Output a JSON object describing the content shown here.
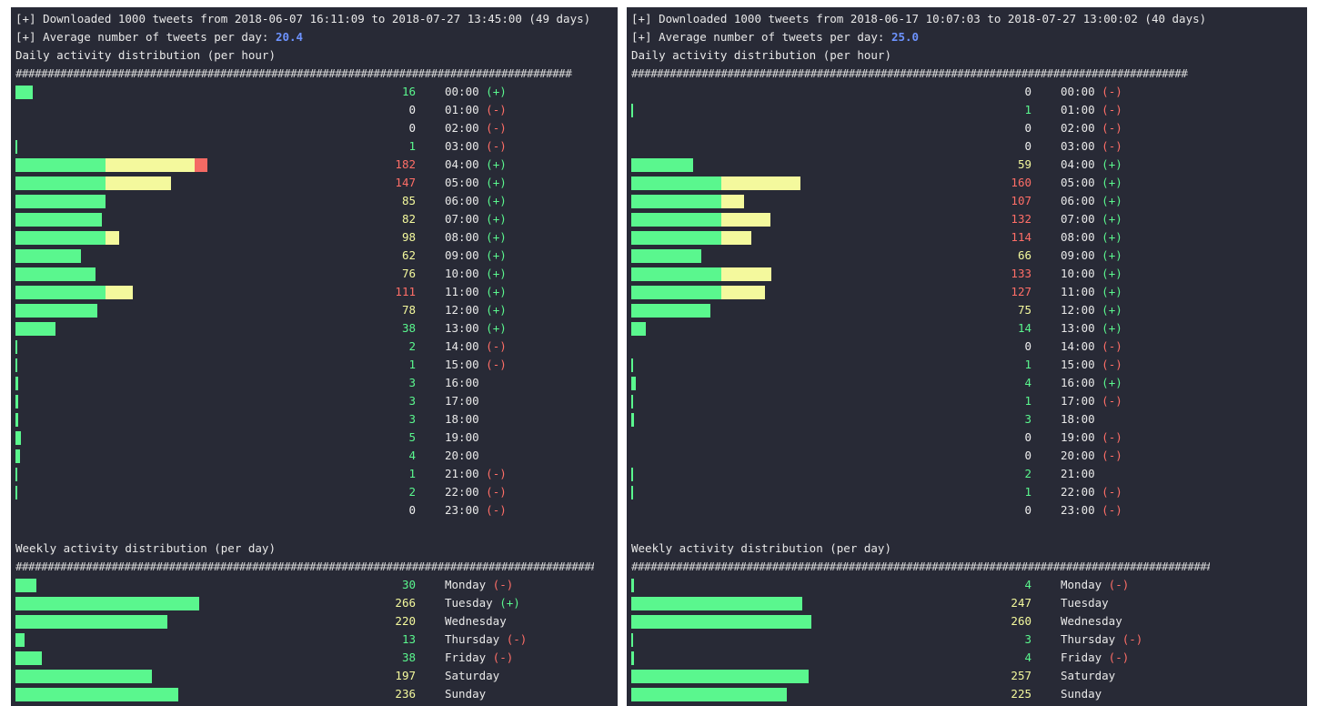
{
  "left": {
    "header": {
      "downloaded": "[+] Downloaded 1000 tweets from 2018-06-07 16:11:09 to 2018-07-27 13:45:00 (49 days)",
      "avg_prefix": "[+] Average number of tweets per day: ",
      "avg_value": "20.4",
      "daily_title": "Daily activity distribution (per hour)",
      "weekly_title": "Weekly activity distribution (per day)"
    },
    "hourly": [
      {
        "count": "16",
        "label": "00:00",
        "mark": "(+)"
      },
      {
        "count": "0",
        "label": "01:00",
        "mark": "(-)"
      },
      {
        "count": "0",
        "label": "02:00",
        "mark": "(-)"
      },
      {
        "count": "1",
        "label": "03:00",
        "mark": "(-)"
      },
      {
        "count": "182",
        "label": "04:00",
        "mark": "(+)"
      },
      {
        "count": "147",
        "label": "05:00",
        "mark": "(+)"
      },
      {
        "count": "85",
        "label": "06:00",
        "mark": "(+)"
      },
      {
        "count": "82",
        "label": "07:00",
        "mark": "(+)"
      },
      {
        "count": "98",
        "label": "08:00",
        "mark": "(+)"
      },
      {
        "count": "62",
        "label": "09:00",
        "mark": "(+)"
      },
      {
        "count": "76",
        "label": "10:00",
        "mark": "(+)"
      },
      {
        "count": "111",
        "label": "11:00",
        "mark": "(+)"
      },
      {
        "count": "78",
        "label": "12:00",
        "mark": "(+)"
      },
      {
        "count": "38",
        "label": "13:00",
        "mark": "(+)"
      },
      {
        "count": "2",
        "label": "14:00",
        "mark": "(-)"
      },
      {
        "count": "1",
        "label": "15:00",
        "mark": "(-)"
      },
      {
        "count": "3",
        "label": "16:00",
        "mark": ""
      },
      {
        "count": "3",
        "label": "17:00",
        "mark": ""
      },
      {
        "count": "3",
        "label": "18:00",
        "mark": ""
      },
      {
        "count": "5",
        "label": "19:00",
        "mark": ""
      },
      {
        "count": "4",
        "label": "20:00",
        "mark": ""
      },
      {
        "count": "1",
        "label": "21:00",
        "mark": "(-)"
      },
      {
        "count": "2",
        "label": "22:00",
        "mark": "(-)"
      },
      {
        "count": "0",
        "label": "23:00",
        "mark": "(-)"
      }
    ],
    "weekly": [
      {
        "count": "30",
        "label": "Monday",
        "mark": "(-)"
      },
      {
        "count": "266",
        "label": "Tuesday",
        "mark": "(+)"
      },
      {
        "count": "220",
        "label": "Wednesday",
        "mark": ""
      },
      {
        "count": "13",
        "label": "Thursday",
        "mark": "(-)"
      },
      {
        "count": "38",
        "label": "Friday",
        "mark": "(-)"
      },
      {
        "count": "197",
        "label": "Saturday",
        "mark": ""
      },
      {
        "count": "236",
        "label": "Sunday",
        "mark": ""
      }
    ]
  },
  "right": {
    "header": {
      "downloaded": "[+] Downloaded 1000 tweets from 2018-06-17 10:07:03 to 2018-07-27 13:00:02 (40 days)",
      "avg_prefix": "[+] Average number of tweets per day: ",
      "avg_value": "25.0",
      "daily_title": "Daily activity distribution (per hour)",
      "weekly_title": "Weekly activity distribution (per day)"
    },
    "hourly": [
      {
        "count": "0",
        "label": "00:00",
        "mark": "(-)"
      },
      {
        "count": "1",
        "label": "01:00",
        "mark": "(-)"
      },
      {
        "count": "0",
        "label": "02:00",
        "mark": "(-)"
      },
      {
        "count": "0",
        "label": "03:00",
        "mark": "(-)"
      },
      {
        "count": "59",
        "label": "04:00",
        "mark": "(+)"
      },
      {
        "count": "160",
        "label": "05:00",
        "mark": "(+)"
      },
      {
        "count": "107",
        "label": "06:00",
        "mark": "(+)"
      },
      {
        "count": "132",
        "label": "07:00",
        "mark": "(+)"
      },
      {
        "count": "114",
        "label": "08:00",
        "mark": "(+)"
      },
      {
        "count": "66",
        "label": "09:00",
        "mark": "(+)"
      },
      {
        "count": "133",
        "label": "10:00",
        "mark": "(+)"
      },
      {
        "count": "127",
        "label": "11:00",
        "mark": "(+)"
      },
      {
        "count": "75",
        "label": "12:00",
        "mark": "(+)"
      },
      {
        "count": "14",
        "label": "13:00",
        "mark": "(+)"
      },
      {
        "count": "0",
        "label": "14:00",
        "mark": "(-)"
      },
      {
        "count": "1",
        "label": "15:00",
        "mark": "(-)"
      },
      {
        "count": "4",
        "label": "16:00",
        "mark": "(+)"
      },
      {
        "count": "1",
        "label": "17:00",
        "mark": "(-)"
      },
      {
        "count": "3",
        "label": "18:00",
        "mark": ""
      },
      {
        "count": "0",
        "label": "19:00",
        "mark": "(-)"
      },
      {
        "count": "0",
        "label": "20:00",
        "mark": "(-)"
      },
      {
        "count": "2",
        "label": "21:00",
        "mark": ""
      },
      {
        "count": "1",
        "label": "22:00",
        "mark": "(-)"
      },
      {
        "count": "0",
        "label": "23:00",
        "mark": "(-)"
      }
    ],
    "weekly": [
      {
        "count": "4",
        "label": "Monday",
        "mark": "(-)"
      },
      {
        "count": "247",
        "label": "Tuesday",
        "mark": ""
      },
      {
        "count": "260",
        "label": "Wednesday",
        "mark": ""
      },
      {
        "count": "3",
        "label": "Thursday",
        "mark": "(-)"
      },
      {
        "count": "4",
        "label": "Friday",
        "mark": "(-)"
      },
      {
        "count": "257",
        "label": "Saturday",
        "mark": ""
      },
      {
        "count": "225",
        "label": "Sunday",
        "mark": ""
      }
    ]
  },
  "colors": {
    "background": "#282a36",
    "low": "#5af78e",
    "mid": "#f4f99d",
    "high": "#ff6e67",
    "accent": "#6d93ff"
  }
}
